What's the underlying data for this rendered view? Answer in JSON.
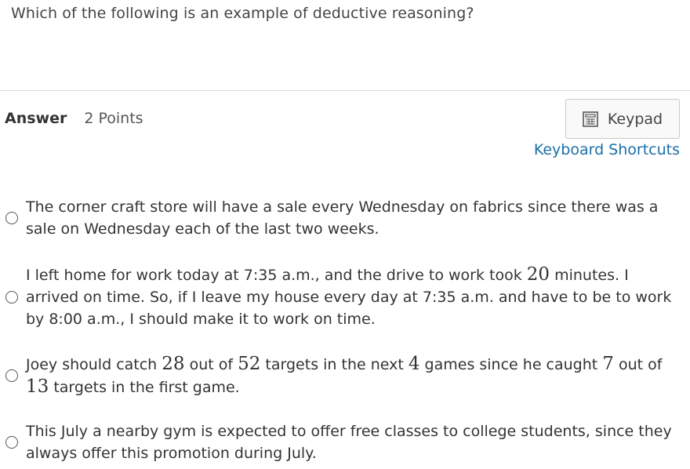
{
  "question": {
    "text": "Which of the following is an example of deductive reasoning?"
  },
  "answer": {
    "label": "Answer",
    "points": "2 Points"
  },
  "toolbar": {
    "keypad_label": "Keypad",
    "keypad_icon": "calculator-icon",
    "shortcuts_label": "Keyboard Shortcuts",
    "link_color": "#1a6fa8"
  },
  "options": [
    {
      "text": "The corner craft store will have a sale every Wednesday on fabrics since there was a sale on Wednesday each of the last two weeks."
    },
    {
      "parts": [
        "I left home for work today at 7:35 a.m., and the drive to work took ",
        "20",
        " minutes. I arrived on time. So, if I leave my house every day at 7:35 a.m. and have to be to work by 8:00 a.m., I should make it to work on time."
      ]
    },
    {
      "parts": [
        "Joey should catch ",
        "28",
        " out of ",
        "52",
        " targets in the next ",
        "4",
        " games since he caught ",
        "7",
        " out of ",
        "13",
        " targets in the first game."
      ]
    },
    {
      "text": "This July a nearby gym is expected to offer free classes to college students, since they always offer this promotion during July."
    }
  ]
}
